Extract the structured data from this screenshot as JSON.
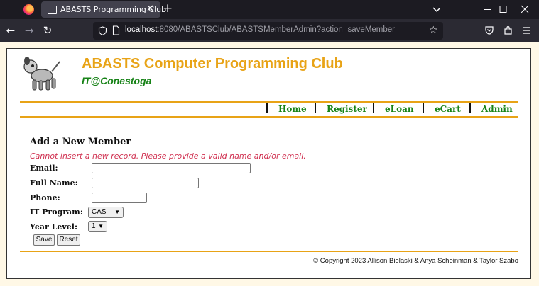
{
  "browser": {
    "tab_title": "ABASTS Programming Club",
    "url_host": "localhost",
    "url_rest": ":8080/ABASTSClub/ABASTSMemberAdmin?action=saveMember"
  },
  "header": {
    "title": "ABASTS Computer Programming Club",
    "subtitle": "IT@Conestoga"
  },
  "menu": [
    "Home",
    "Register",
    "eLoan",
    "eCart",
    "Admin"
  ],
  "form": {
    "title": "Add a New Member",
    "error": "Cannot insert a new record. Please provide a valid name and/or email.",
    "email_label": "Email:",
    "fullname_label": "Full Name:",
    "phone_label": "Phone:",
    "program_label": "IT Program:",
    "program_value": "CAS",
    "year_label": "Year Level:",
    "year_value": "1",
    "save_label": "Save",
    "reset_label": "Reset"
  },
  "footer": {
    "copyright": "© Copyright 2023 Allison Bielaski & Anya Scheinman & Taylor Szabo"
  },
  "colors": {
    "accent_orange": "#e8a316",
    "link_green": "#168216",
    "error_red": "#d03050"
  }
}
